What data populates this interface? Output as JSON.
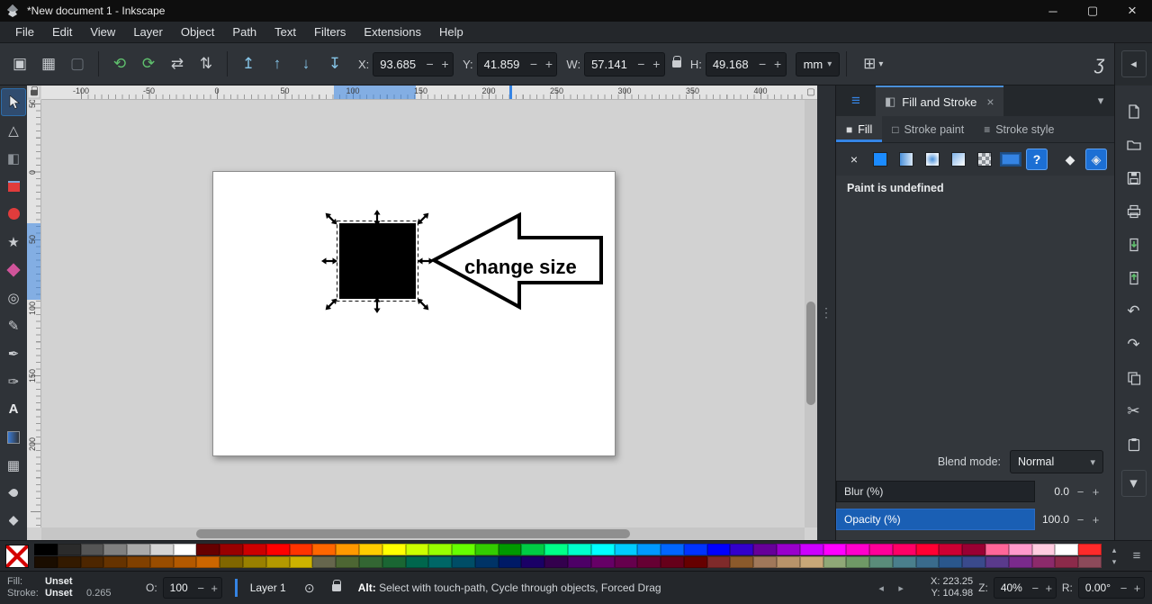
{
  "window": {
    "title": "*New document 1 - Inkscape",
    "minimize": "─",
    "maximize": "▢",
    "close": "×"
  },
  "menubar": {
    "items": [
      "File",
      "Edit",
      "View",
      "Layer",
      "Object",
      "Path",
      "Text",
      "Filters",
      "Extensions",
      "Help"
    ]
  },
  "toolbar": {
    "x_label": "X:",
    "x_value": "93.685",
    "y_label": "Y:",
    "y_value": "41.859",
    "w_label": "W:",
    "w_value": "57.141",
    "h_label": "H:",
    "h_value": "49.168",
    "unit": "mm"
  },
  "icons": {
    "minus": "−",
    "plus": "+",
    "select_all": "▣",
    "select_all_layers": "▦",
    "deselect": "▢",
    "rotate_ccw": "⟲",
    "rotate_cw": "⟳",
    "flip_h": "⇄",
    "flip_v": "⇅",
    "raise_top": "↥",
    "raise": "↑",
    "lower": "↓",
    "lower_bottom": "↧",
    "scale_options": "⊞",
    "snap": "ʒ",
    "collapse": "◂",
    "dropdown": "▾",
    "chevron_up": "▴",
    "chevron_down": "▾",
    "chevron_left": "◂",
    "chevron_right": "▸",
    "menu": "≡",
    "dots": "⋮",
    "eye": "⊙",
    "node_tool": "△",
    "shape_builder": "◧",
    "star_tool": "★",
    "spiral_tool": "◎",
    "pencil_tool": "✎",
    "pen_tool": "✒",
    "calligraphy_tool": "✑",
    "text_tool": "A",
    "mesh_tool": "▦",
    "objects_tab": "≡",
    "fillstroke_tab": "◧",
    "close_small": "×",
    "fill_tab": "■",
    "stroke_paint_tab": "□",
    "stroke_style_tab": "≡",
    "none_paint": "×",
    "unknown_paint": "?",
    "fill_rule_nonzero": "◆",
    "fill_rule_evenodd": "◈",
    "undo": "↶",
    "redo": "↷",
    "cut": "✂",
    "corner_page": "▢"
  },
  "rulers": {
    "h_labels": [
      "-100",
      "-50",
      "0",
      "50",
      "100",
      "150",
      "200",
      "250",
      "300",
      "350",
      "400"
    ],
    "v_labels": [
      "50",
      "0",
      "50",
      "100",
      "150",
      "200"
    ]
  },
  "canvas": {
    "annotation": "change size"
  },
  "dock": {
    "tab_title": "Fill and Stroke",
    "fill_tab": "Fill",
    "stroke_paint_tab": "Stroke paint",
    "stroke_style_tab": "Stroke style",
    "paint_status": "Paint is undefined",
    "blend_label": "Blend mode:",
    "blend_value": "Normal",
    "blur_label": "Blur (%)",
    "blur_value": "0.0",
    "opacity_label": "Opacity (%)",
    "opacity_value": "100.0"
  },
  "statusbar": {
    "fill_label": "Fill:",
    "fill_value": "Unset",
    "stroke_label": "Stroke:",
    "stroke_value": "Unset",
    "stroke_width": "0.265",
    "opacity_label": "O:",
    "opacity_value": "100",
    "layer_name": "Layer 1",
    "message_bold": "Alt:",
    "message_rest": " Select with touch-path, Cycle through objects, Forced Drag",
    "x_label": "X:",
    "x_value": "223.25",
    "y_label": "Y:",
    "y_value": "104.98",
    "zoom_label": "Z:",
    "zoom_value": "40%",
    "rotation_label": "R:",
    "rotation_value": "0.00°"
  },
  "palette": {
    "row1": [
      "#000000",
      "#2b2b2b",
      "#555555",
      "#808080",
      "#aaaaaa",
      "#d4d4d4",
      "#ffffff",
      "#660000",
      "#990000",
      "#cc0000",
      "#ff0000",
      "#ff3300",
      "#ff6600",
      "#ff9900",
      "#ffcc00",
      "#ffff00",
      "#ccff00",
      "#99ff00",
      "#66ff00",
      "#33cc00",
      "#009900",
      "#00cc44",
      "#00ff88",
      "#00ffcc",
      "#00ffff",
      "#00ccff",
      "#0099ff",
      "#0066ff",
      "#0033ff",
      "#0000ff",
      "#3300cc",
      "#660099",
      "#9900cc",
      "#cc00ff",
      "#ff00ff",
      "#ff00cc",
      "#ff0099",
      "#ff0066",
      "#ff0033",
      "#cc0033",
      "#990033",
      "#ff6699",
      "#ff99cc",
      "#ffcce0",
      "#ffffff",
      "#ff2a2a"
    ],
    "row2": [
      "#1a0d00",
      "#331a00",
      "#4d2600",
      "#663300",
      "#804000",
      "#994d00",
      "#b35900",
      "#cc6600",
      "#806600",
      "#998000",
      "#b39900",
      "#ccb300",
      "#66664d",
      "#4d6633",
      "#336633",
      "#1a6633",
      "#00664d",
      "#006666",
      "#004d66",
      "#003366",
      "#001a66",
      "#1a0066",
      "#33004d",
      "#4d0066",
      "#660066",
      "#66004d",
      "#660033",
      "#66001a",
      "#660000",
      "#7f2a2a",
      "#8b5a2b",
      "#a0785a",
      "#b8946a",
      "#c8a878",
      "#8fa877",
      "#6f9966",
      "#5a8c7a",
      "#4a7f8c",
      "#3a6b8c",
      "#2a578c",
      "#3a4a8c",
      "#5a3a8c",
      "#7a2a8c",
      "#8c2a6b",
      "#8c2a4a",
      "#8c4a5a"
    ]
  }
}
